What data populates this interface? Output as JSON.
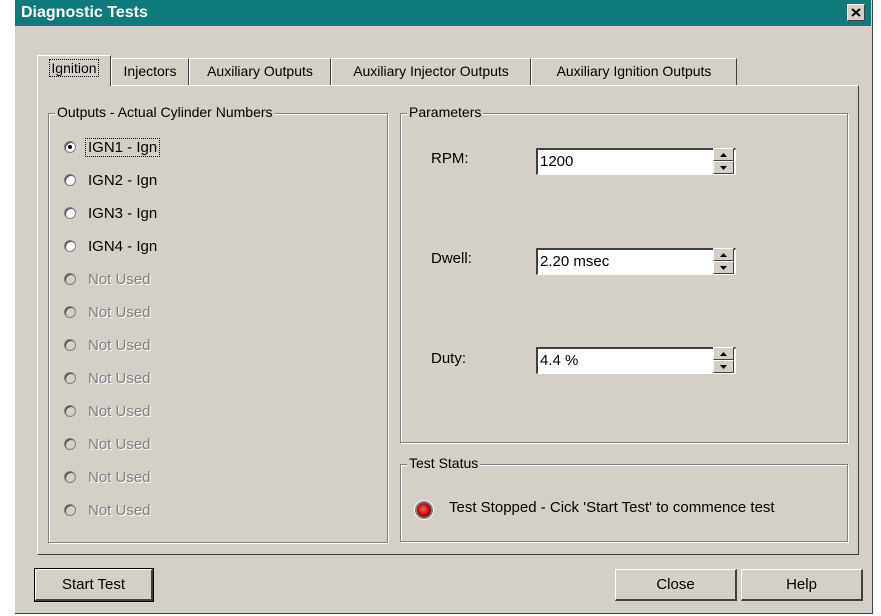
{
  "window": {
    "title": "Diagnostic Tests"
  },
  "tabs": [
    {
      "label": "Ignition"
    },
    {
      "label": "Injectors"
    },
    {
      "label": "Auxiliary Outputs"
    },
    {
      "label": "Auxiliary Injector Outputs"
    },
    {
      "label": "Auxiliary Ignition Outputs"
    }
  ],
  "outputs": {
    "title": "Outputs - Actual Cylinder Numbers",
    "selected": "IGN1 - Ign",
    "items": [
      {
        "label": "IGN1 - Ign",
        "enabled": true,
        "checked": true
      },
      {
        "label": "IGN2 - Ign",
        "enabled": true,
        "checked": false
      },
      {
        "label": "IGN3 - Ign",
        "enabled": true,
        "checked": false
      },
      {
        "label": "IGN4 - Ign",
        "enabled": true,
        "checked": false
      },
      {
        "label": "Not Used",
        "enabled": false,
        "checked": false
      },
      {
        "label": "Not Used",
        "enabled": false,
        "checked": false
      },
      {
        "label": "Not Used",
        "enabled": false,
        "checked": false
      },
      {
        "label": "Not Used",
        "enabled": false,
        "checked": false
      },
      {
        "label": "Not Used",
        "enabled": false,
        "checked": false
      },
      {
        "label": "Not Used",
        "enabled": false,
        "checked": false
      },
      {
        "label": "Not Used",
        "enabled": false,
        "checked": false
      },
      {
        "label": "Not Used",
        "enabled": false,
        "checked": false
      }
    ]
  },
  "parameters": {
    "title": "Parameters",
    "rpm": {
      "label": "RPM:",
      "value": "1200"
    },
    "dwell": {
      "label": "Dwell:",
      "value": "2.20 msec"
    },
    "duty": {
      "label": "Duty:",
      "value": "4.4 %"
    }
  },
  "status": {
    "title": "Test Status",
    "text": "Test Stopped - Cick 'Start Test' to commence test",
    "indicator_color": "#c00000"
  },
  "buttons": {
    "start": "Start Test",
    "close": "Close",
    "help": "Help"
  },
  "colors": {
    "titlebar": "#0e7a7a",
    "face": "#d4d0c8"
  }
}
